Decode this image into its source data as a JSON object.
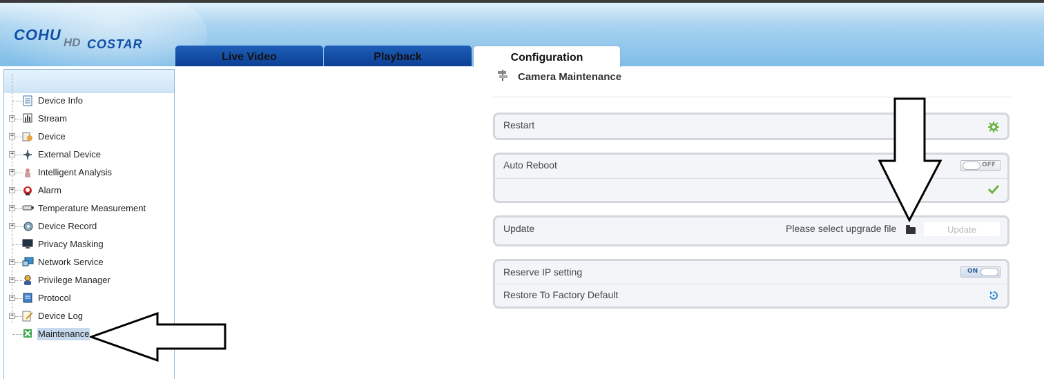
{
  "header": {
    "logo": {
      "cohu": "COHU",
      "hd": "HD",
      "costar": "COSTAR"
    },
    "tabs": [
      {
        "label": "Live Video",
        "active": false
      },
      {
        "label": "Playback",
        "active": false
      },
      {
        "label": "Configuration",
        "active": true
      }
    ]
  },
  "sidebar": {
    "items": [
      {
        "label": "Device Info",
        "icon": "document-icon",
        "expandable": false
      },
      {
        "label": "Stream",
        "icon": "stream-icon",
        "expandable": true
      },
      {
        "label": "Device",
        "icon": "device-icon",
        "expandable": true
      },
      {
        "label": "External Device",
        "icon": "external-device-icon",
        "expandable": true
      },
      {
        "label": "Intelligent Analysis",
        "icon": "intelligent-analysis-icon",
        "expandable": true
      },
      {
        "label": "Alarm",
        "icon": "alarm-icon",
        "expandable": true
      },
      {
        "label": "Temperature Measurement",
        "icon": "camera-icon",
        "expandable": true
      },
      {
        "label": "Device Record",
        "icon": "record-icon",
        "expandable": true
      },
      {
        "label": "Privacy Masking",
        "icon": "monitor-icon",
        "expandable": false
      },
      {
        "label": "Network Service",
        "icon": "network-icon",
        "expandable": true
      },
      {
        "label": "Privilege Manager",
        "icon": "users-icon",
        "expandable": true
      },
      {
        "label": "Protocol",
        "icon": "protocol-icon",
        "expandable": true
      },
      {
        "label": "Device Log",
        "icon": "log-icon",
        "expandable": true
      },
      {
        "label": "Maintenance",
        "icon": "maintenance-icon",
        "expandable": false,
        "selected": true
      }
    ]
  },
  "main": {
    "title": "Camera Maintenance",
    "restart": {
      "label": "Restart"
    },
    "auto_reboot": {
      "label": "Auto Reboot",
      "toggle": "OFF"
    },
    "update": {
      "label": "Update",
      "hint": "Please select upgrade file",
      "button": "Update"
    },
    "reserve_ip": {
      "label": "Reserve IP setting",
      "toggle": "ON"
    },
    "factory": {
      "label": "Restore To Factory Default"
    }
  },
  "colors": {
    "accent": "#0f4fa8",
    "tab_inactive": "#1a55ad",
    "sidebar_border": "#8fb8dc"
  }
}
